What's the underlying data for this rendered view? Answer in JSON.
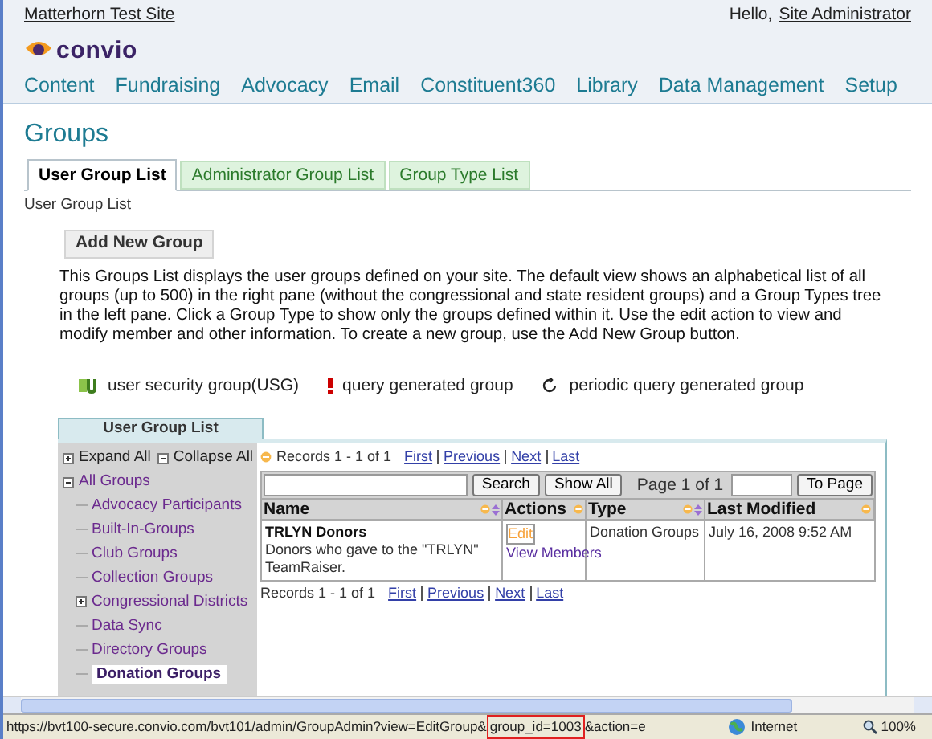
{
  "header": {
    "site_link": "Matterhorn Test Site",
    "greeting": "Hello,",
    "user_link": "Site Administrator",
    "logo_text": "convio"
  },
  "nav": [
    {
      "label": "Content"
    },
    {
      "label": "Fundraising"
    },
    {
      "label": "Advocacy"
    },
    {
      "label": "Email"
    },
    {
      "label": "Constituent360"
    },
    {
      "label": "Library"
    },
    {
      "label": "Data Management"
    },
    {
      "label": "Setup"
    }
  ],
  "page_title": "Groups",
  "tabs": [
    {
      "label": "User Group List",
      "selected": true
    },
    {
      "label": "Administrator Group List",
      "selected": false
    },
    {
      "label": "Group Type List",
      "selected": false
    }
  ],
  "breadcrumb": "User Group List",
  "add_button": "Add New Group",
  "description": "This Groups List displays the user groups defined on your site. The default view shows an alphabetical list of all groups (up to 500) in the right pane (without the congressional and state resident groups) and a Group Types tree in the left pane. Click a Group Type to show only the groups defined within it. Use the edit action to view and modify member and other information. To create a new group, use the Add New Group button.",
  "legend": [
    {
      "kind": "usg",
      "label": "user security group(USG)"
    },
    {
      "kind": "query",
      "label": "query generated group"
    },
    {
      "kind": "periodic",
      "label": "periodic query generated group"
    }
  ],
  "panel": {
    "title": "User Group List",
    "tree": {
      "expand_all": "Expand All",
      "collapse_all": "Collapse All",
      "root": {
        "label": "All Groups",
        "expanded": true,
        "children": [
          {
            "label": "Advocacy Participants",
            "selected": false,
            "expandable": false
          },
          {
            "label": "Built-In-Groups",
            "selected": false,
            "expandable": false
          },
          {
            "label": "Club Groups",
            "selected": false,
            "expandable": false
          },
          {
            "label": "Collection Groups",
            "selected": false,
            "expandable": false
          },
          {
            "label": "Congressional Districts",
            "selected": false,
            "expandable": true
          },
          {
            "label": "Data Sync",
            "selected": false,
            "expandable": false
          },
          {
            "label": "Directory Groups",
            "selected": false,
            "expandable": false
          },
          {
            "label": "Donation Groups",
            "selected": true,
            "expandable": false
          }
        ]
      }
    },
    "top_pager": {
      "records": "Records 1 - 1 of 1",
      "links": [
        "First",
        "Previous",
        "Next",
        "Last"
      ]
    },
    "search_button": "Search",
    "show_all_button": "Show All",
    "page_info": "Page 1 of 1",
    "to_page_button": "To Page",
    "columns": [
      {
        "label": "Name",
        "sortable": true
      },
      {
        "label": "Actions",
        "sortable": false
      },
      {
        "label": "Type",
        "sortable": true
      },
      {
        "label": "Last Modified",
        "sortable": false
      }
    ],
    "rows": [
      {
        "name": "TRLYN Donors",
        "description": "Donors who gave to the \"TRLYN\" TeamRaiser.",
        "actions": [
          "Edit",
          "View Members"
        ],
        "type": "Donation Groups",
        "last_modified": "July 16, 2008 9:52 AM"
      }
    ],
    "bottom_pager": {
      "records": "Records 1 - 1 of 1",
      "links": [
        "First",
        "Previous",
        "Next",
        "Last"
      ]
    }
  },
  "status_bar": {
    "url_before": "https://bvt100-secure.convio.com/bvt101/admin/GroupAdmin?view=EditGroup&",
    "url_highlight": "group_id=1003",
    "url_after": "&action=e",
    "zone": "Internet",
    "zoom": "100%"
  }
}
